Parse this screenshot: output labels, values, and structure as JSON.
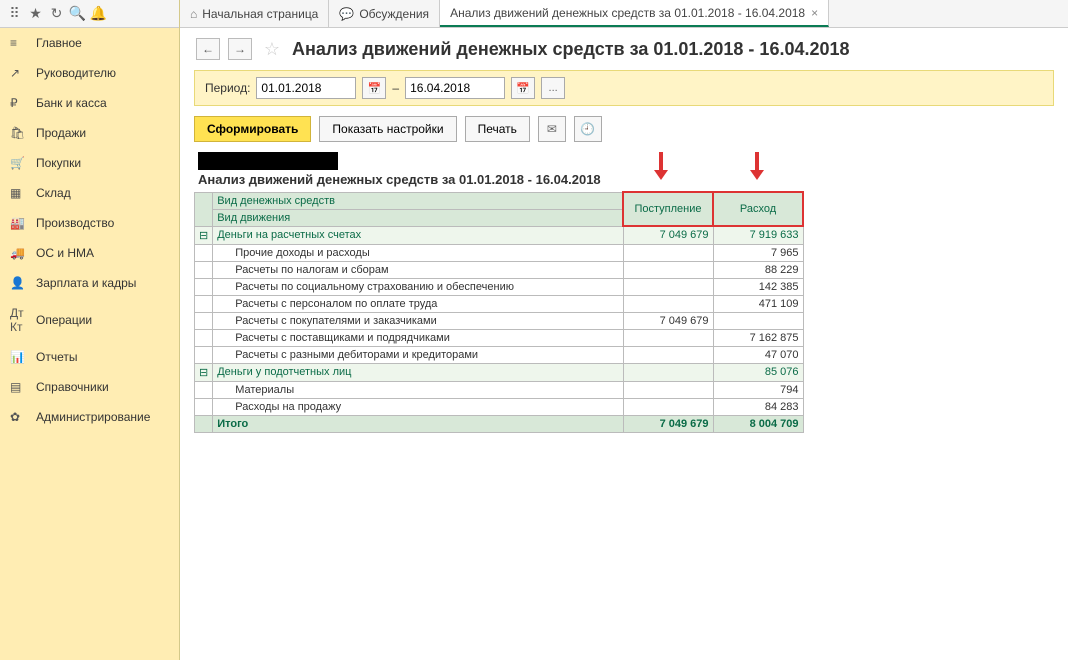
{
  "sidebar": {
    "items": [
      {
        "icon": "≡",
        "label": "Главное"
      },
      {
        "icon": "↗",
        "label": "Руководителю"
      },
      {
        "icon": "₽",
        "label": "Банк и касса"
      },
      {
        "icon": "🛍",
        "label": "Продажи"
      },
      {
        "icon": "🛒",
        "label": "Покупки"
      },
      {
        "icon": "▦",
        "label": "Склад"
      },
      {
        "icon": "🏭",
        "label": "Производство"
      },
      {
        "icon": "🚚",
        "label": "ОС и НМА"
      },
      {
        "icon": "👤",
        "label": "Зарплата и кадры"
      },
      {
        "icon": "Дт Кт",
        "label": "Операции"
      },
      {
        "icon": "📊",
        "label": "Отчеты"
      },
      {
        "icon": "▤",
        "label": "Справочники"
      },
      {
        "icon": "✿",
        "label": "Администрирование"
      }
    ]
  },
  "tabs": [
    {
      "icon": "⌂",
      "label": "Начальная страница",
      "active": false,
      "closable": false
    },
    {
      "icon": "💬",
      "label": "Обсуждения",
      "active": false,
      "closable": false
    },
    {
      "icon": "",
      "label": "Анализ движений денежных средств за 01.01.2018 - 16.04.2018",
      "active": true,
      "closable": true
    }
  ],
  "page": {
    "title": "Анализ движений денежных средств за 01.01.2018 - 16.04.2018"
  },
  "period": {
    "label": "Период:",
    "from": "01.01.2018",
    "to": "16.04.2018",
    "dash": "–"
  },
  "actions": {
    "primary": "Сформировать",
    "settings": "Показать настройки",
    "print": "Печать"
  },
  "report": {
    "title": "Анализ движений денежных средств за 01.01.2018 - 16.04.2018",
    "header_kind": "Вид денежных средств",
    "header_move": "Вид движения",
    "col_in": "Поступление",
    "col_out": "Расход",
    "groups": [
      {
        "label": "Деньги на расчетных счетах",
        "in": "7 049 679",
        "out": "7 919 633",
        "rows": [
          {
            "label": "Прочие доходы и расходы",
            "in": "",
            "out": "7 965"
          },
          {
            "label": "Расчеты по налогам и сборам",
            "in": "",
            "out": "88 229"
          },
          {
            "label": "Расчеты по социальному страхованию и обеспечению",
            "in": "",
            "out": "142 385"
          },
          {
            "label": "Расчеты с персоналом по оплате труда",
            "in": "",
            "out": "471 109"
          },
          {
            "label": "Расчеты с покупателями и заказчиками",
            "in": "7 049 679",
            "out": ""
          },
          {
            "label": "Расчеты с поставщиками и подрядчиками",
            "in": "",
            "out": "7 162 875"
          },
          {
            "label": "Расчеты с разными дебиторами и кредиторами",
            "in": "",
            "out": "47 070"
          }
        ]
      },
      {
        "label": "Деньги у подотчетных лиц",
        "in": "",
        "out": "85 076",
        "rows": [
          {
            "label": "Материалы",
            "in": "",
            "out": "794"
          },
          {
            "label": "Расходы на продажу",
            "in": "",
            "out": "84 283"
          }
        ]
      }
    ],
    "total_label": "Итого",
    "total_in": "7 049 679",
    "total_out": "8 004 709"
  }
}
